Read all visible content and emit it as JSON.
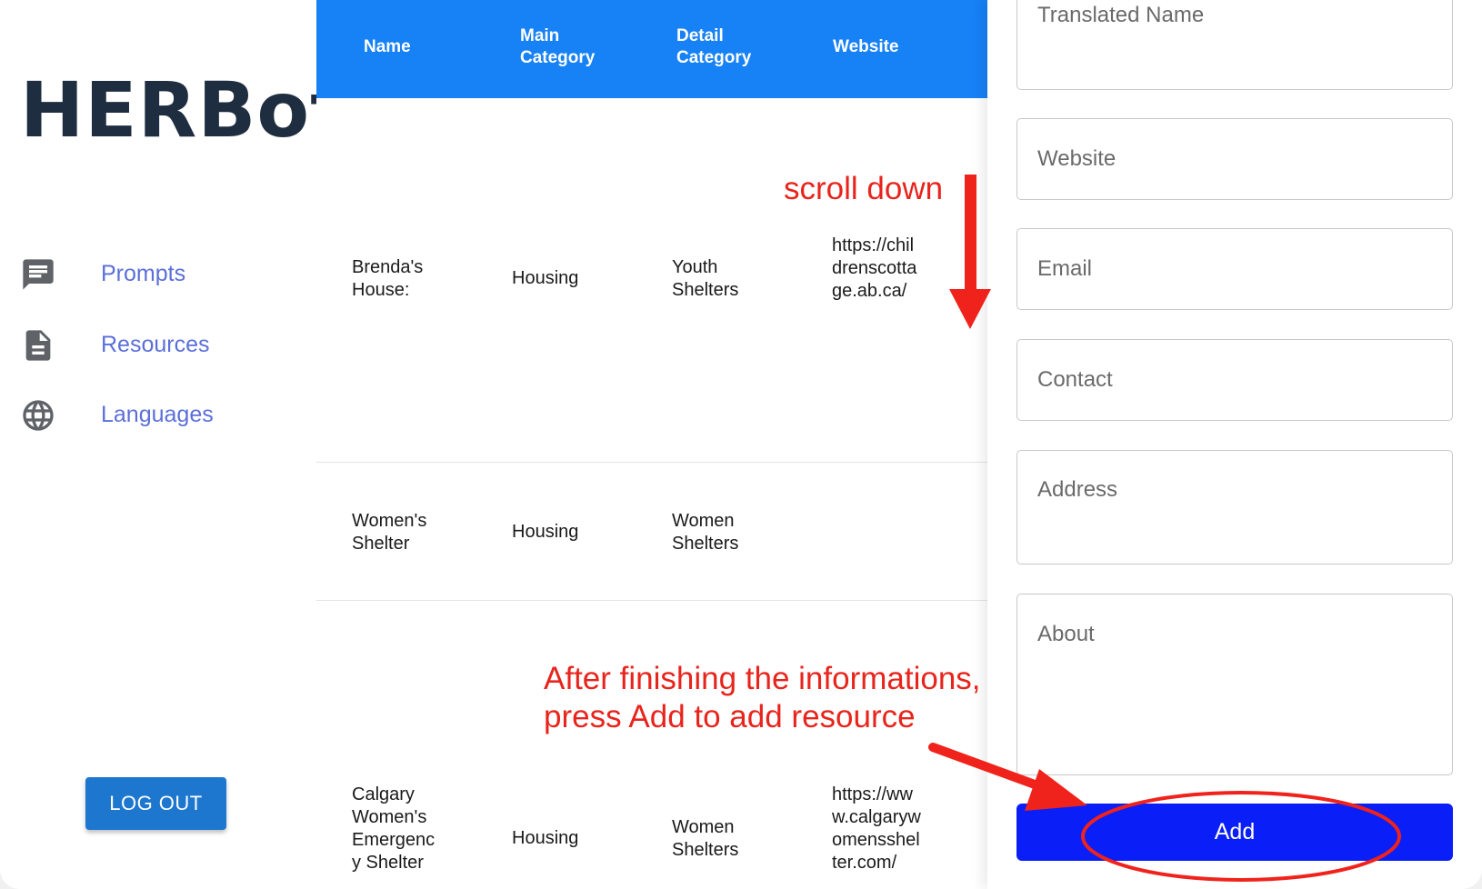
{
  "sidebar": {
    "logo": "HERBot",
    "nav": [
      {
        "label": "Prompts",
        "icon": "chat-bubble-icon"
      },
      {
        "label": "Resources",
        "icon": "document-icon"
      },
      {
        "label": "Languages",
        "icon": "globe-icon"
      }
    ],
    "logout_label": "LOG OUT"
  },
  "table": {
    "headers": [
      "Name",
      "Main Category",
      "Detail Category",
      "Website"
    ],
    "rows": [
      {
        "name": "Brenda's House:",
        "main": "Housing",
        "detail": "Youth Shelters",
        "website": "https://childrenscottage.ab.ca/"
      },
      {
        "name": "Women's Shelter",
        "main": "Housing",
        "detail": "Women Shelters",
        "website": ""
      },
      {
        "name": "Calgary Women's Emergency Shelter",
        "main": "Housing",
        "detail": "Women Shelters",
        "website": "https://www.calgarywomensshelter.com/"
      }
    ]
  },
  "form": {
    "fields": [
      {
        "placeholder": "Translated Name"
      },
      {
        "placeholder": "Website"
      },
      {
        "placeholder": "Email"
      },
      {
        "placeholder": "Contact"
      },
      {
        "placeholder": "Address"
      },
      {
        "placeholder": "About"
      }
    ],
    "add_label": "Add"
  },
  "annotations": {
    "scroll": "scroll down",
    "finish_line1": "After finishing the informations,",
    "finish_line2": "press Add to add resource",
    "color": "#e8241c"
  },
  "colors": {
    "header_blue": "#1781f6",
    "add_button": "#0a1ef7",
    "logout_button": "#1e77cf",
    "nav_text": "#5b6fd9"
  }
}
